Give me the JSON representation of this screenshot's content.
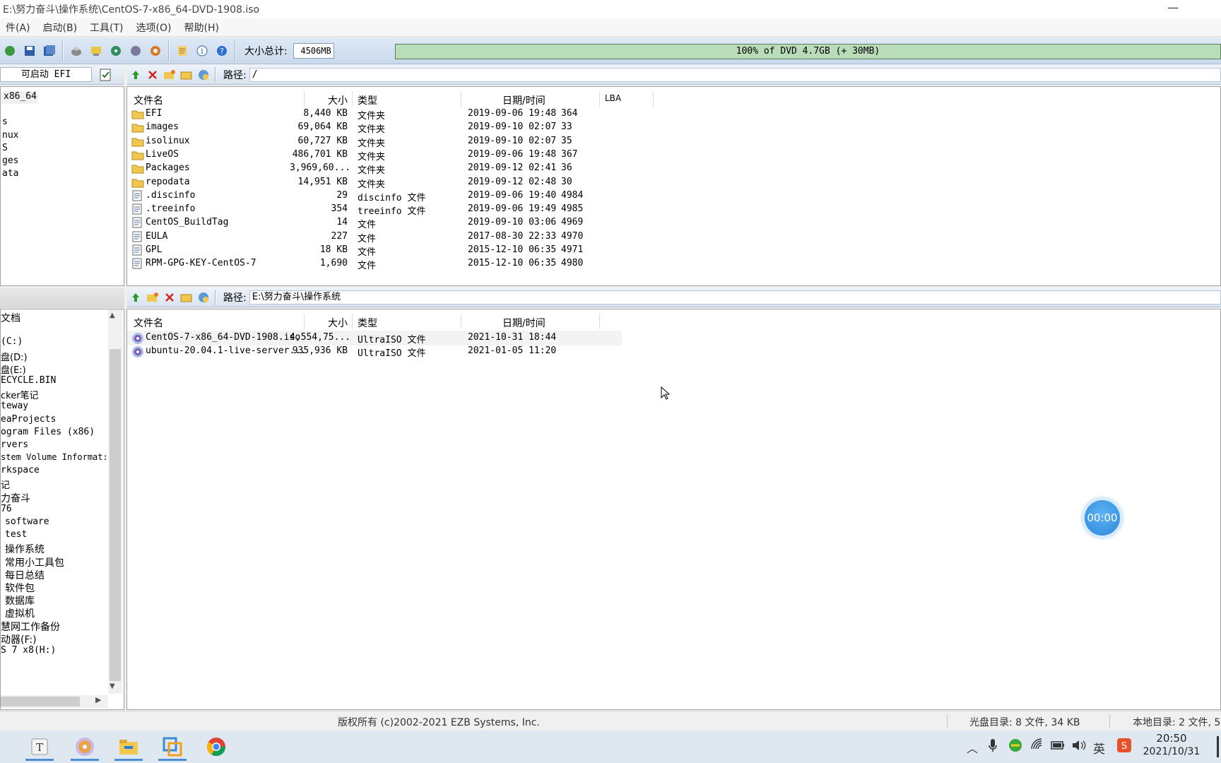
{
  "window": {
    "title": "E:\\努力奋斗\\操作系统\\CentOS-7-x86_64-DVD-1908.iso",
    "minimize": "—"
  },
  "menu": [
    "件(A)",
    "启动(B)",
    "工具(T)",
    "选项(O)",
    "帮助(H)"
  ],
  "toolbar": {
    "size_label": "大小总计:",
    "size_value": "4506MB",
    "progress_text": "100% of DVD 4.7GB (+ 30MB)",
    "progress_fraction": 1.0
  },
  "iso_panel": {
    "boot_label": "可启动 EFI",
    "tree": [
      "x86_64",
      "",
      "s",
      "nux",
      "S",
      "ges",
      "ata"
    ],
    "path_label": "路径:",
    "path_value": "/",
    "columns": {
      "name": "文件名",
      "size": "大小",
      "type": "类型",
      "date": "日期/时间",
      "lba": "LBA"
    },
    "files": [
      {
        "name": "EFI",
        "size": "8,440 KB",
        "type": "文件夹",
        "date": "2019-09-06 19:48",
        "lba": "364",
        "kind": "folder"
      },
      {
        "name": "images",
        "size": "69,064 KB",
        "type": "文件夹",
        "date": "2019-09-10 02:07",
        "lba": "33",
        "kind": "folder"
      },
      {
        "name": "isolinux",
        "size": "60,727 KB",
        "type": "文件夹",
        "date": "2019-09-10 02:07",
        "lba": "35",
        "kind": "folder"
      },
      {
        "name": "LiveOS",
        "size": "486,701 KB",
        "type": "文件夹",
        "date": "2019-09-06 19:48",
        "lba": "367",
        "kind": "folder"
      },
      {
        "name": "Packages",
        "size": "3,969,60...",
        "type": "文件夹",
        "date": "2019-09-12 02:41",
        "lba": "36",
        "kind": "folder"
      },
      {
        "name": "repodata",
        "size": "14,951 KB",
        "type": "文件夹",
        "date": "2019-09-12 02:48",
        "lba": "30",
        "kind": "folder"
      },
      {
        "name": ".discinfo",
        "size": "29",
        "type": "discinfo 文件",
        "date": "2019-09-06 19:40",
        "lba": "4984",
        "kind": "file"
      },
      {
        "name": ".treeinfo",
        "size": "354",
        "type": "treeinfo 文件",
        "date": "2019-09-06 19:49",
        "lba": "4985",
        "kind": "file"
      },
      {
        "name": "CentOS_BuildTag",
        "size": "14",
        "type": "文件",
        "date": "2019-09-10 03:06",
        "lba": "4969",
        "kind": "file"
      },
      {
        "name": "EULA",
        "size": "227",
        "type": "文件",
        "date": "2017-08-30 22:33",
        "lba": "4970",
        "kind": "file"
      },
      {
        "name": "GPL",
        "size": "18 KB",
        "type": "文件",
        "date": "2015-12-10 06:35",
        "lba": "4971",
        "kind": "file"
      },
      {
        "name": "RPM-GPG-KEY-CentOS-7",
        "size": "1,690",
        "type": "文件",
        "date": "2015-12-10 06:35",
        "lba": "4980",
        "kind": "file"
      }
    ]
  },
  "local_panel": {
    "tree": [
      "文档",
      "",
      "(C:)",
      "盘(D:)",
      "盘(E:)",
      "ECYCLE.BIN",
      "cker笔记",
      "teway",
      "eaProjects",
      "ogram Files (x86)",
      "rvers",
      "stem Volume Informat:",
      "rkspace",
      "记",
      "力奋斗",
      "76",
      "software",
      "test",
      "操作系统",
      "常用小工具包",
      "每日总结",
      "软件包",
      "数据库",
      "虚拟机",
      "慧网工作备份",
      "动器(F:)",
      "S 7 x8(H:)"
    ],
    "path_label": "路径:",
    "path_value": "E:\\努力奋斗\\操作系统",
    "columns": {
      "name": "文件名",
      "size": "大小",
      "type": "类型",
      "date": "日期/时间"
    },
    "files": [
      {
        "name": "CentOS-7-x86_64-DVD-1908.iso",
        "size": "4,554,75...",
        "type": "UltraISO 文件",
        "date": "2021-10-31 18:44"
      },
      {
        "name": "ubuntu-20.04.1-live-server...",
        "size": "935,936 KB",
        "type": "UltraISO 文件",
        "date": "2021-01-05 11:20"
      }
    ]
  },
  "status": {
    "copyright": "版权所有 (c)2002-2021 EZB Systems, Inc.",
    "disc_dir": "光盘目录: 8 文件, 34 KB",
    "local_dir": "本地目录: 2 文件, 5"
  },
  "overlay": {
    "timer": "00:00"
  },
  "taskbar": {
    "clock_time": "20:50",
    "clock_date": "2021/10/31",
    "ime": "英"
  },
  "colors": {
    "accent": "#2a86da",
    "progress": "#b9dcb9",
    "toolbar": "#c9d9ec"
  }
}
